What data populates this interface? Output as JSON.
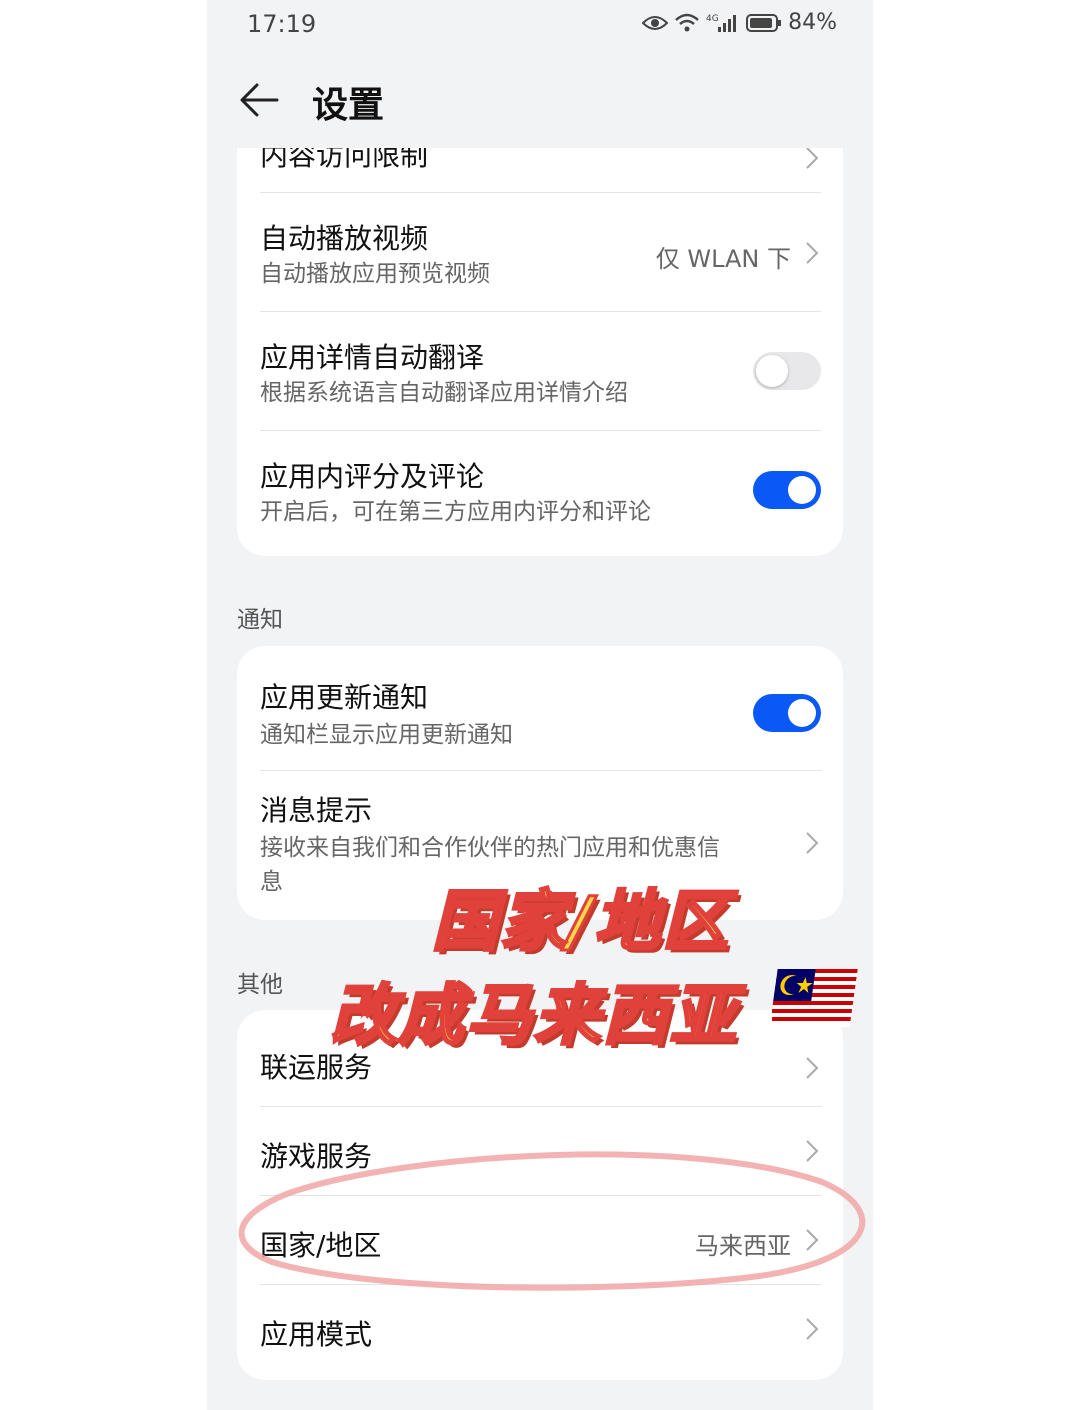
{
  "status_bar": {
    "time": "17:19",
    "battery": "84%",
    "network": "4G"
  },
  "header": {
    "title": "设置"
  },
  "card1": {
    "partial_item": "内容访问限制",
    "items": [
      {
        "title": "自动播放视频",
        "subtitle": "自动播放应用预览视频",
        "value": "仅 WLAN 下"
      },
      {
        "title": "应用详情自动翻译",
        "subtitle": "根据系统语言自动翻译应用详情介绍",
        "toggle": "off"
      },
      {
        "title": "应用内评分及评论",
        "subtitle": "开启后，可在第三方应用内评分和评论",
        "toggle": "on"
      }
    ]
  },
  "notify": {
    "header": "通知",
    "items": [
      {
        "title": "应用更新通知",
        "subtitle": "通知栏显示应用更新通知",
        "toggle": "on"
      },
      {
        "title": "消息提示",
        "subtitle_line1": "接收来自我们和合作伙伴的热门应用和优惠信",
        "subtitle_line2": "息"
      }
    ]
  },
  "other": {
    "header": "其他",
    "items": [
      {
        "title": "联运服务"
      },
      {
        "title": "游戏服务"
      },
      {
        "title": "国家/地区",
        "value": "马来西亚"
      },
      {
        "title": "应用模式"
      }
    ]
  },
  "overlay": {
    "line1": "国家/地区",
    "line2": "改成马来西亚"
  },
  "colors": {
    "accent": "#0a59f7",
    "overlay_fill": "#ffd84a",
    "overlay_stroke": "#e0413a",
    "highlight_circle": "#f2a6a6"
  }
}
